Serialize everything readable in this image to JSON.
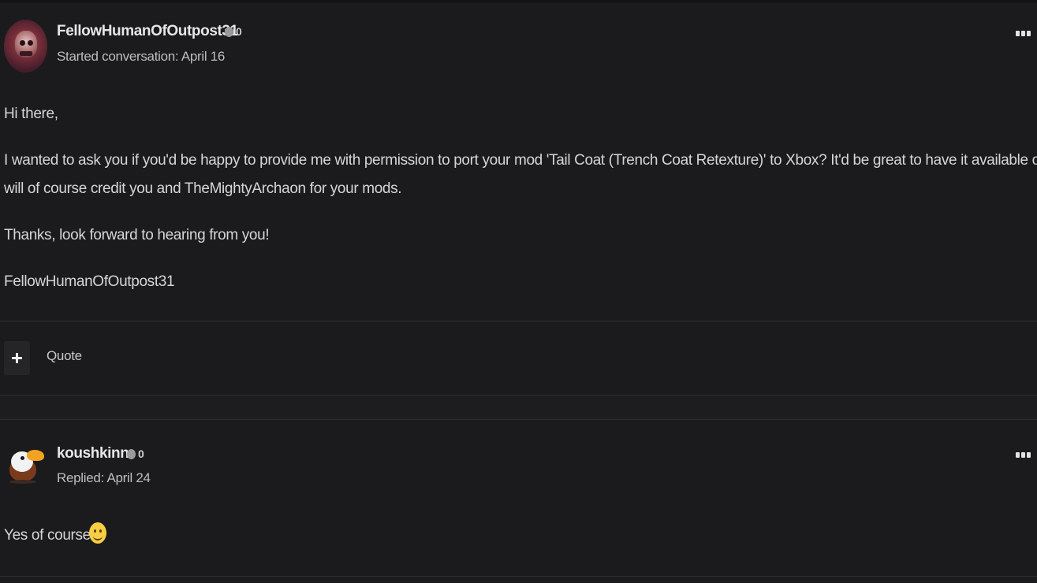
{
  "post1": {
    "author": "FellowHumanOfOutpost31",
    "reputation": "0",
    "meta": "Started conversation: April 16",
    "avatar_icon": "skull-avatar-icon",
    "menu_icon": "ellipsis-icon",
    "paragraphs": [
      "Hi there,",
      "I wanted to ask you if you'd be happy to provide me with permission to port your mod 'Tail Coat (Trench Coat Retexture)' to Xbox? It'd be great to have it available on console. I",
      "will of course credit you and TheMightyArchaon for your mods.",
      "Thanks, look forward to hearing from you!",
      "FellowHumanOfOutpost31"
    ],
    "actions": {
      "add_icon": "plus-icon",
      "quote_label": "Quote"
    }
  },
  "post2": {
    "author": "koushkinn",
    "reputation": "0",
    "meta": "Replied: April 24",
    "avatar_icon": "eagle-avatar-icon",
    "menu_icon": "ellipsis-icon",
    "text": "Yes of course",
    "emoji_icon": "smiley-emoji-icon"
  },
  "colors": {
    "background": "#1b1b1d",
    "text": "#d6d6d6",
    "divider": "#2f2f33",
    "reputation_dot": "#9a9a9a"
  }
}
